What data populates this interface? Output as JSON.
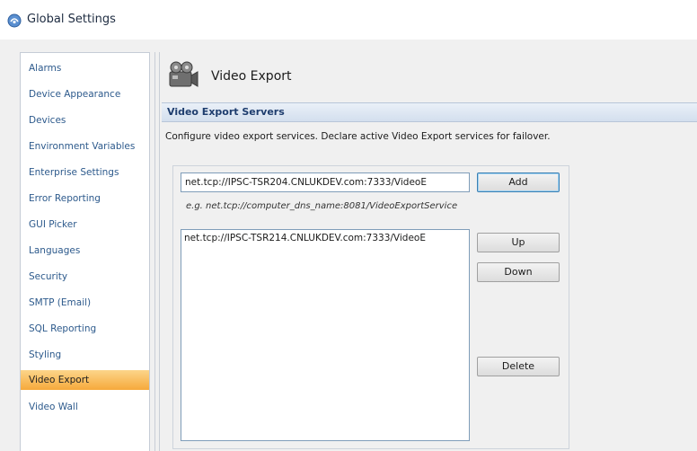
{
  "window": {
    "title": "Global Settings",
    "icon": "globe-settings-icon"
  },
  "sidebar": {
    "items": [
      {
        "label": "Alarms"
      },
      {
        "label": "Device Appearance"
      },
      {
        "label": "Devices"
      },
      {
        "label": "Environment Variables"
      },
      {
        "label": "Enterprise Settings"
      },
      {
        "label": "Error Reporting"
      },
      {
        "label": "GUI Picker"
      },
      {
        "label": "Languages"
      },
      {
        "label": "Security"
      },
      {
        "label": "SMTP (Email)"
      },
      {
        "label": "SQL Reporting"
      },
      {
        "label": "Styling"
      },
      {
        "label": "Video Export",
        "active": true
      },
      {
        "label": "Video Wall"
      }
    ],
    "active_label": "Video Export",
    "active_color": "#f6a93b"
  },
  "page": {
    "title": "Video Export",
    "icon": "film-reel-icon",
    "section_header": "Video Export Servers",
    "description": "Configure video export services. Declare active Video Export services for failover.",
    "server_input_value": "net.tcp://IPSC-TSR204.CNLUKDEV.com:7333/VideoE",
    "add_label": "Add",
    "example": "e.g. net.tcp://computer_dns_name:8081/VideoExportService",
    "servers": [
      "net.tcp://IPSC-TSR214.CNLUKDEV.com:7333/VideoE"
    ],
    "up_label": "Up",
    "down_label": "Down",
    "delete_label": "Delete"
  }
}
